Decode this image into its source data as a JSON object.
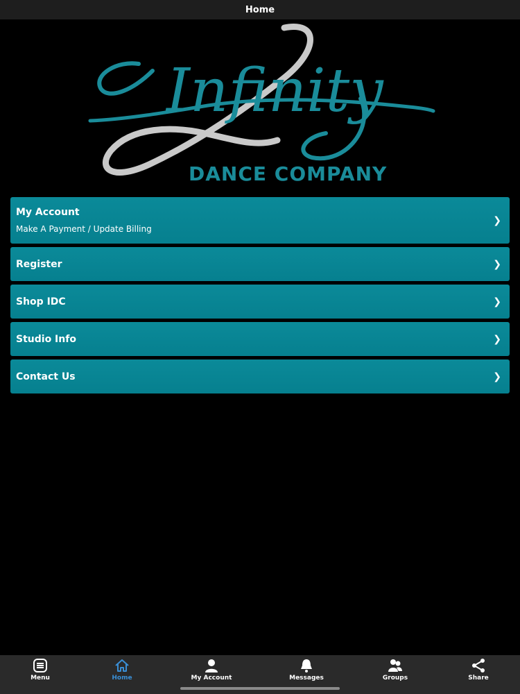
{
  "topbar": {
    "title": "Home"
  },
  "logo": {
    "script_text": "Infinity",
    "subtitle": "DANCE COMPANY"
  },
  "menu": [
    {
      "label": "My Account",
      "sub": "Make A Payment / Update Billing"
    },
    {
      "label": "Register"
    },
    {
      "label": "Shop IDC"
    },
    {
      "label": "Studio Info"
    },
    {
      "label": "Contact Us"
    }
  ],
  "chevron": "❯",
  "tabs": [
    {
      "label": "Menu",
      "icon": "menu-icon"
    },
    {
      "label": "Home",
      "icon": "home-icon",
      "active": true
    },
    {
      "label": "My Account",
      "icon": "person-icon"
    },
    {
      "label": "Messages",
      "icon": "bell-icon"
    },
    {
      "label": "Groups",
      "icon": "groups-icon"
    },
    {
      "label": "Share",
      "icon": "share-icon"
    }
  ],
  "colors": {
    "menu_bg": "#0b8a99",
    "logo_teal": "#1a8c9a",
    "logo_silver": "#c9c9c9",
    "active_tab": "#3a8fd6"
  }
}
